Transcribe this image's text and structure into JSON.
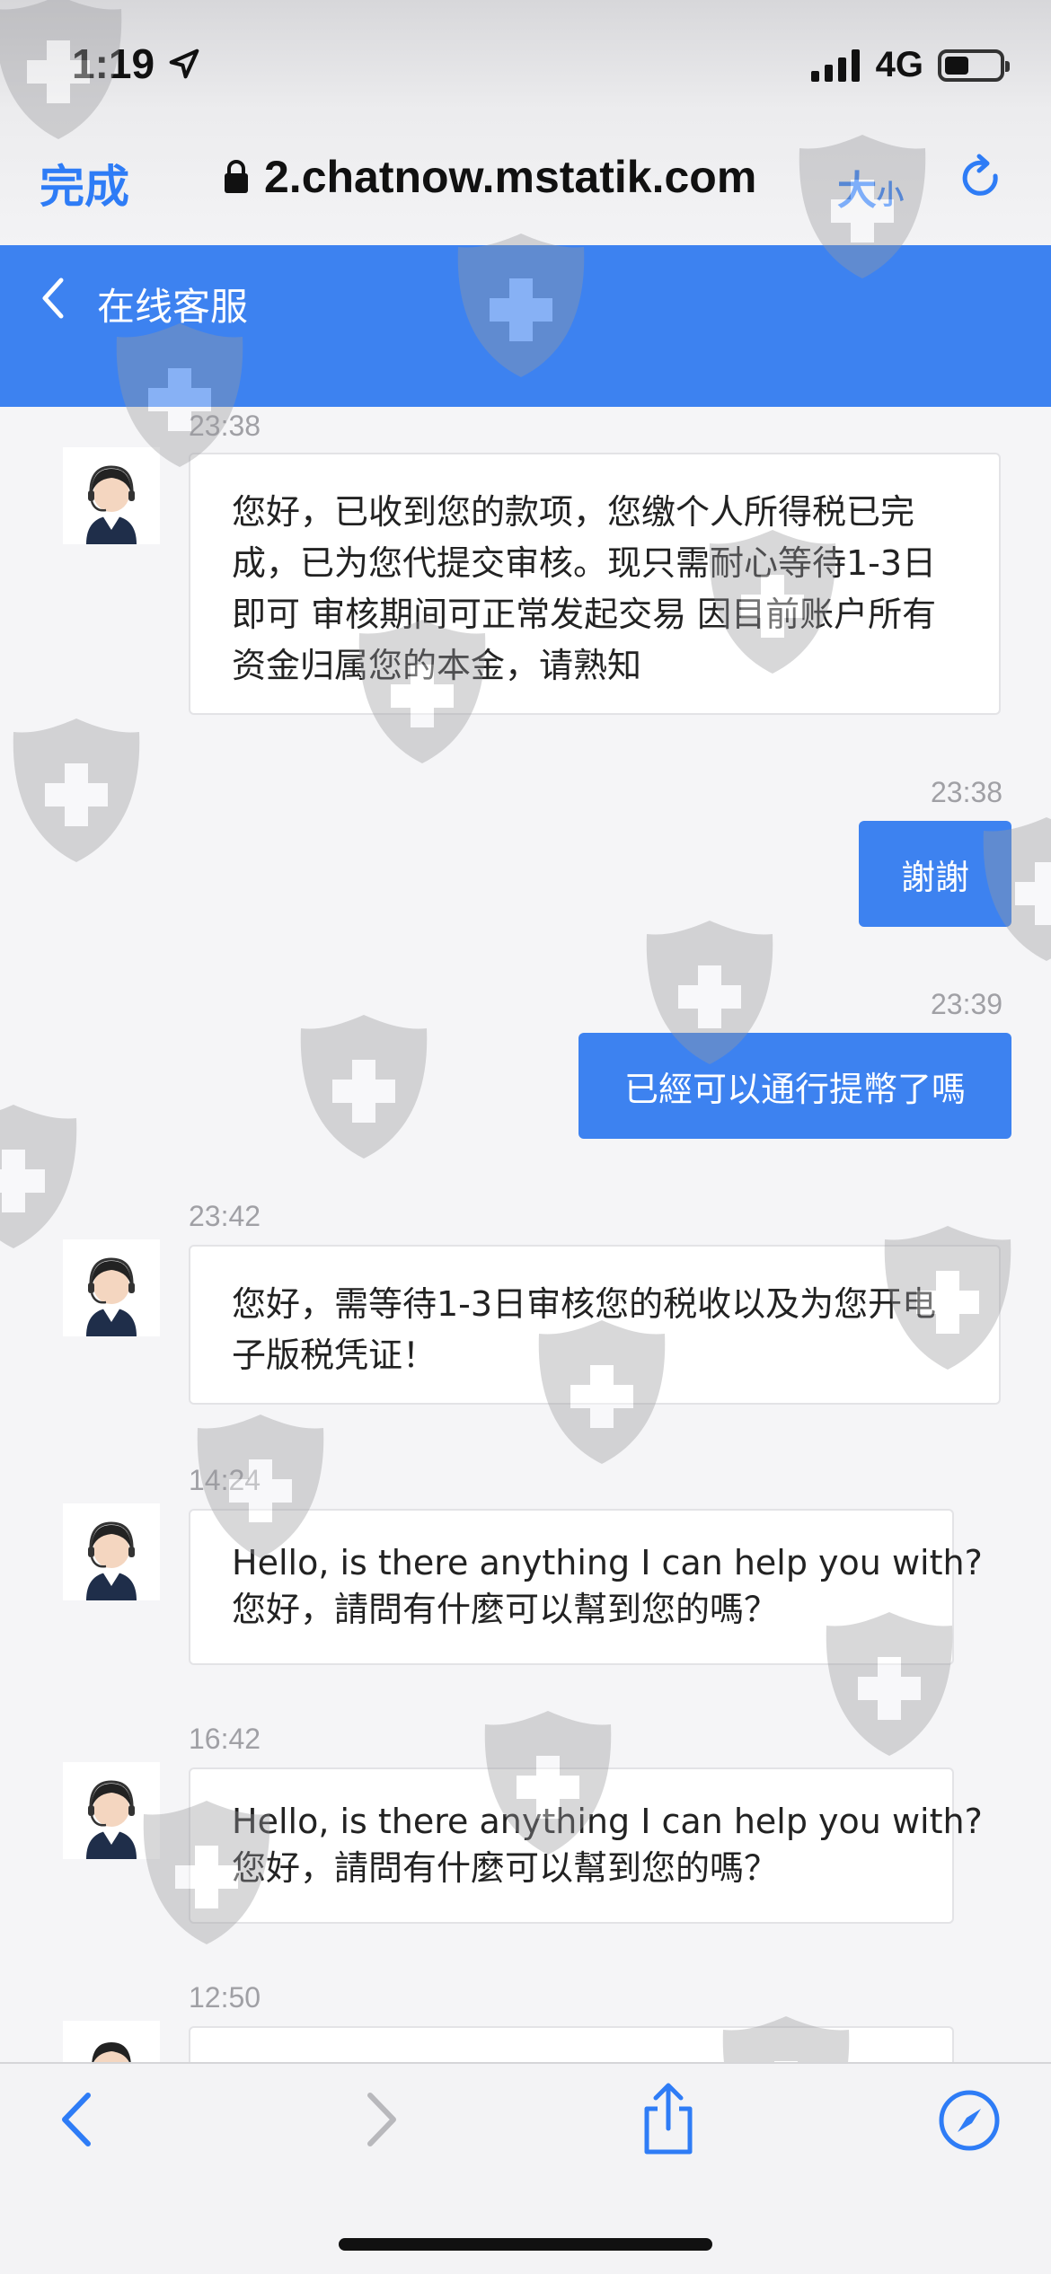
{
  "status_bar": {
    "time": "1:19",
    "network": "4G"
  },
  "browser": {
    "done_label": "完成",
    "url": "2.chatnow.mstatik.com",
    "size_big": "大",
    "size_small": "小"
  },
  "header": {
    "title": "在线客服"
  },
  "messages": [
    {
      "time": "23:38",
      "from": "agent",
      "lines": [
        "您好，已收到您的款项，您缴个人所得税已完",
        "成，已为您代提交审核。现只需耐心等待1-3日",
        "即可 审核期间可正常发起交易 因目前账户所有",
        "资金归属您的本金，请熟知"
      ]
    },
    {
      "time": "23:38",
      "from": "user",
      "text": "謝謝"
    },
    {
      "time": "23:39",
      "from": "user",
      "text": "已經可以通行提幣了嗎"
    },
    {
      "time": "23:42",
      "from": "agent",
      "lines": [
        "您好，需等待1-3日审核您的税收以及为您开电",
        "子版税凭证！"
      ]
    },
    {
      "time": "14:24",
      "from": "agent",
      "lines": [
        "Hello, is there anything I can help you with?",
        "您好，請問有什麼可以幫到您的嗎？"
      ]
    },
    {
      "time": "16:42",
      "from": "agent",
      "lines": [
        "Hello, is there anything I can help you with?",
        "您好，請問有什麼可以幫到您的嗎？"
      ]
    },
    {
      "time": "12:50",
      "from": "agent",
      "lines": []
    }
  ],
  "icons": {
    "location": "location-arrow-icon",
    "lock": "lock-icon",
    "reload": "reload-icon",
    "back": "chevron-left-icon",
    "share": "share-icon",
    "compass": "compass-icon",
    "watermark": "shield-plus-watermark-icon"
  },
  "colors": {
    "accent": "#3d82f0",
    "link": "#2e7cf6"
  }
}
